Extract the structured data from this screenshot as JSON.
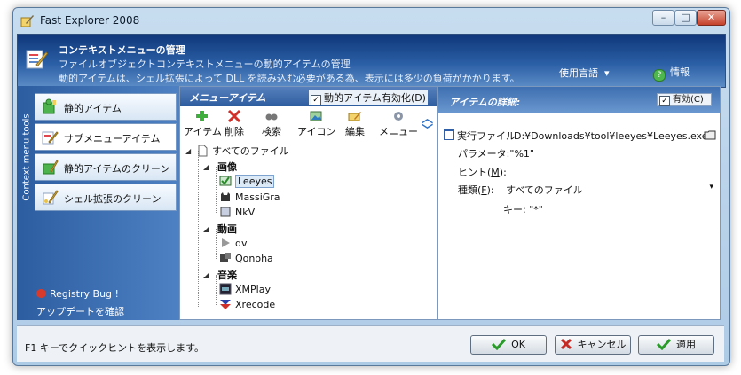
{
  "window": {
    "title": "Fast Explorer 2008"
  },
  "banner": {
    "title": "コンテキストメニューの管理",
    "line1": "ファイルオブジェクトコンテキストメニューの動的アイテムの管理",
    "line2": "動的アイテムは、シェル拡張によって DLL を読み込む必要がある為、表示には多少の負荷がかかります。",
    "language_menu": "使用言語",
    "info": "情報"
  },
  "sidebar": {
    "vertical_label": "Context menu tools",
    "items": [
      {
        "label": "静的アイテム"
      },
      {
        "label": "サブメニューアイテム"
      },
      {
        "label": "静的アイテムのクリーン"
      },
      {
        "label": "シェル拡張のクリーン"
      }
    ],
    "registry_bug": "Registry Bug !",
    "check_update": "アップデートを確認"
  },
  "menu_panel": {
    "title": "メニューアイテム",
    "enable_dynamic": "動的アイテム有効化(D)",
    "toolbar": [
      {
        "label": "アイテム"
      },
      {
        "label": "削除"
      },
      {
        "label": "検索"
      },
      {
        "label": "アイコン"
      },
      {
        "label": "編集"
      },
      {
        "label": "メニュー"
      }
    ],
    "tree": {
      "root": "すべてのファイル",
      "groups": [
        {
          "name": "画像",
          "items": [
            "Leeyes",
            "MassiGra",
            "NkV"
          ]
        },
        {
          "name": "動画",
          "items": [
            "dv",
            "Qonoha"
          ]
        },
        {
          "name": "音楽",
          "items": [
            "XMPlay",
            "Xrecode"
          ]
        }
      ]
    }
  },
  "detail_panel": {
    "title": "アイテムの詳細:",
    "valid_label": "有効(C)",
    "exec_label": "実行ファイル",
    "exec_value": "D:¥Downloads¥tool¥leeyes¥Leeyes.exe",
    "param_label": "パラメータ:",
    "param_value": "\"%1\"",
    "hint_label": "ヒント(",
    "hint_key": "M",
    "hint_tail": "):",
    "type_label": "種類(",
    "type_key": "F",
    "type_tail": "):",
    "type_value": "すべてのファイル",
    "key_label": "キー:",
    "key_value": "\"*\""
  },
  "footer": {
    "hint": "F1 キーでクイックヒントを表示します。",
    "ok": "OK",
    "cancel": "キャンセル",
    "apply": "適用"
  }
}
